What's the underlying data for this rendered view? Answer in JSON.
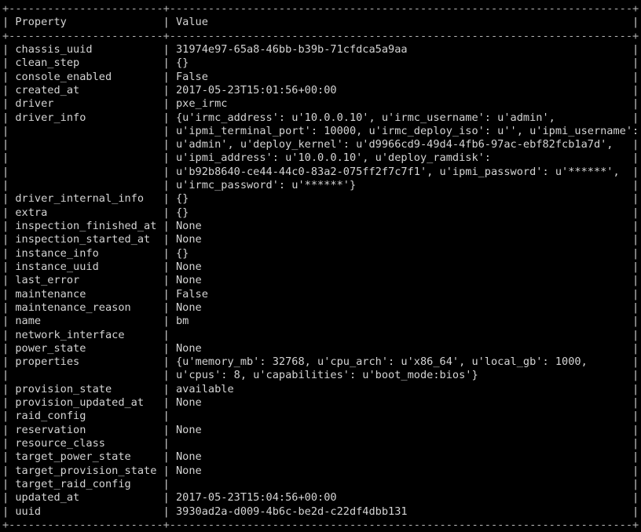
{
  "terminal": {
    "kind": "openstack-ironic-node-show-table",
    "colors": {
      "background": "#000000",
      "foreground": "#d4d4d4",
      "border": "#b0b0b0"
    },
    "geometry": {
      "char_width": 8.12,
      "line_height": 17.32,
      "total_columns": 99,
      "property_column_width": 24,
      "value_column_width": 72
    },
    "border_chars": {
      "corner": "+",
      "horizontal": "-",
      "vertical": "|"
    },
    "header": {
      "property_label": "Property",
      "value_label": "Value"
    },
    "rows": [
      {
        "property": "chassis_uuid",
        "values": [
          "31974e97-65a8-46bb-b39b-71cfdca5a9aa"
        ]
      },
      {
        "property": "clean_step",
        "values": [
          "{}"
        ]
      },
      {
        "property": "console_enabled",
        "values": [
          "False"
        ]
      },
      {
        "property": "created_at",
        "values": [
          "2017-05-23T15:01:56+00:00"
        ]
      },
      {
        "property": "driver",
        "values": [
          "pxe_irmc"
        ]
      },
      {
        "property": "driver_info",
        "values": [
          "{u'irmc_address': u'10.0.0.10', u'irmc_username': u'admin',",
          "u'ipmi_terminal_port': 10000, u'irmc_deploy_iso': u'', u'ipmi_username':",
          "u'admin', u'deploy_kernel': u'd9966cd9-49d4-4fb6-97ac-ebf82fcb1a7d',",
          "u'ipmi_address': u'10.0.0.10', u'deploy_ramdisk':",
          "u'b92b8640-ce44-44c0-83a2-075ff2f7c7f1', u'ipmi_password': u'******',",
          "u'irmc_password': u'******'}"
        ]
      },
      {
        "property": "driver_internal_info",
        "values": [
          "{}"
        ]
      },
      {
        "property": "extra",
        "values": [
          "{}"
        ]
      },
      {
        "property": "inspection_finished_at",
        "values": [
          "None"
        ]
      },
      {
        "property": "inspection_started_at",
        "values": [
          "None"
        ]
      },
      {
        "property": "instance_info",
        "values": [
          "{}"
        ]
      },
      {
        "property": "instance_uuid",
        "values": [
          "None"
        ]
      },
      {
        "property": "last_error",
        "values": [
          "None"
        ]
      },
      {
        "property": "maintenance",
        "values": [
          "False"
        ]
      },
      {
        "property": "maintenance_reason",
        "values": [
          "None"
        ]
      },
      {
        "property": "name",
        "values": [
          "bm"
        ]
      },
      {
        "property": "network_interface",
        "values": [
          ""
        ]
      },
      {
        "property": "power_state",
        "values": [
          "None"
        ]
      },
      {
        "property": "properties",
        "values": [
          "{u'memory_mb': 32768, u'cpu_arch': u'x86_64', u'local_gb': 1000,",
          "u'cpus': 8, u'capabilities': u'boot_mode:bios'}"
        ]
      },
      {
        "property": "provision_state",
        "values": [
          "available"
        ]
      },
      {
        "property": "provision_updated_at",
        "values": [
          "None"
        ]
      },
      {
        "property": "raid_config",
        "values": [
          ""
        ]
      },
      {
        "property": "reservation",
        "values": [
          "None"
        ]
      },
      {
        "property": "resource_class",
        "values": [
          ""
        ]
      },
      {
        "property": "target_power_state",
        "values": [
          "None"
        ]
      },
      {
        "property": "target_provision_state",
        "values": [
          "None"
        ]
      },
      {
        "property": "target_raid_config",
        "values": [
          ""
        ]
      },
      {
        "property": "updated_at",
        "values": [
          "2017-05-23T15:04:56+00:00"
        ]
      },
      {
        "property": "uuid",
        "values": [
          "3930ad2a-d009-4b6c-be2d-c22df4dbb131"
        ]
      }
    ]
  }
}
